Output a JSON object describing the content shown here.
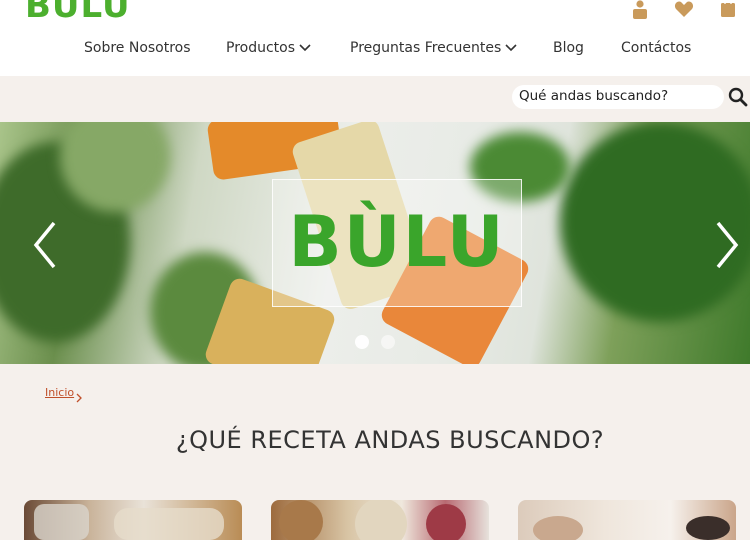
{
  "brand": {
    "logo_text": "BULU",
    "hero_text": "BÙLU",
    "accent": "#4caf2e"
  },
  "header_icons": [
    "user-icon",
    "heart-icon",
    "bag-icon"
  ],
  "nav": {
    "items": [
      {
        "label": "Sobre Nosotros",
        "has_dropdown": false
      },
      {
        "label": "Productos",
        "has_dropdown": true
      },
      {
        "label": "Preguntas Frecuentes",
        "has_dropdown": true
      },
      {
        "label": "Blog",
        "has_dropdown": false
      },
      {
        "label": "Contáctos",
        "has_dropdown": false
      }
    ]
  },
  "search": {
    "text": "Qué andas buscando?"
  },
  "carousel": {
    "slides": 2,
    "active_slide": 1
  },
  "breadcrumb": {
    "home": "Inicio"
  },
  "section": {
    "title": "¿QUÉ RECETA ANDAS BUSCANDO?"
  },
  "cards": [
    "honey-card",
    "granola-card",
    "massage-card"
  ]
}
